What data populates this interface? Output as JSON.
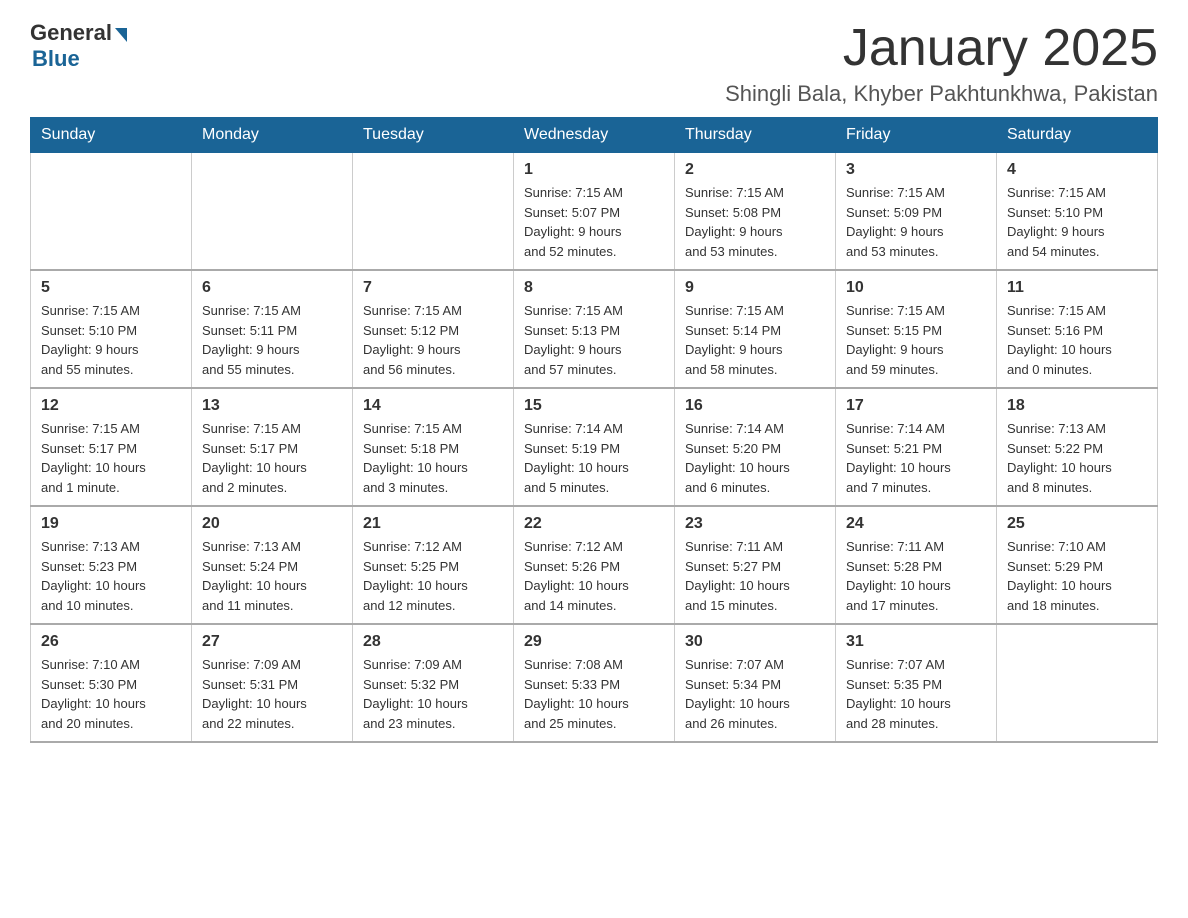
{
  "logo": {
    "general": "General",
    "blue": "Blue"
  },
  "title": "January 2025",
  "location": "Shingli Bala, Khyber Pakhtunkhwa, Pakistan",
  "headers": [
    "Sunday",
    "Monday",
    "Tuesday",
    "Wednesday",
    "Thursday",
    "Friday",
    "Saturday"
  ],
  "weeks": [
    [
      {
        "day": "",
        "info": ""
      },
      {
        "day": "",
        "info": ""
      },
      {
        "day": "",
        "info": ""
      },
      {
        "day": "1",
        "info": "Sunrise: 7:15 AM\nSunset: 5:07 PM\nDaylight: 9 hours\nand 52 minutes."
      },
      {
        "day": "2",
        "info": "Sunrise: 7:15 AM\nSunset: 5:08 PM\nDaylight: 9 hours\nand 53 minutes."
      },
      {
        "day": "3",
        "info": "Sunrise: 7:15 AM\nSunset: 5:09 PM\nDaylight: 9 hours\nand 53 minutes."
      },
      {
        "day": "4",
        "info": "Sunrise: 7:15 AM\nSunset: 5:10 PM\nDaylight: 9 hours\nand 54 minutes."
      }
    ],
    [
      {
        "day": "5",
        "info": "Sunrise: 7:15 AM\nSunset: 5:10 PM\nDaylight: 9 hours\nand 55 minutes."
      },
      {
        "day": "6",
        "info": "Sunrise: 7:15 AM\nSunset: 5:11 PM\nDaylight: 9 hours\nand 55 minutes."
      },
      {
        "day": "7",
        "info": "Sunrise: 7:15 AM\nSunset: 5:12 PM\nDaylight: 9 hours\nand 56 minutes."
      },
      {
        "day": "8",
        "info": "Sunrise: 7:15 AM\nSunset: 5:13 PM\nDaylight: 9 hours\nand 57 minutes."
      },
      {
        "day": "9",
        "info": "Sunrise: 7:15 AM\nSunset: 5:14 PM\nDaylight: 9 hours\nand 58 minutes."
      },
      {
        "day": "10",
        "info": "Sunrise: 7:15 AM\nSunset: 5:15 PM\nDaylight: 9 hours\nand 59 minutes."
      },
      {
        "day": "11",
        "info": "Sunrise: 7:15 AM\nSunset: 5:16 PM\nDaylight: 10 hours\nand 0 minutes."
      }
    ],
    [
      {
        "day": "12",
        "info": "Sunrise: 7:15 AM\nSunset: 5:17 PM\nDaylight: 10 hours\nand 1 minute."
      },
      {
        "day": "13",
        "info": "Sunrise: 7:15 AM\nSunset: 5:17 PM\nDaylight: 10 hours\nand 2 minutes."
      },
      {
        "day": "14",
        "info": "Sunrise: 7:15 AM\nSunset: 5:18 PM\nDaylight: 10 hours\nand 3 minutes."
      },
      {
        "day": "15",
        "info": "Sunrise: 7:14 AM\nSunset: 5:19 PM\nDaylight: 10 hours\nand 5 minutes."
      },
      {
        "day": "16",
        "info": "Sunrise: 7:14 AM\nSunset: 5:20 PM\nDaylight: 10 hours\nand 6 minutes."
      },
      {
        "day": "17",
        "info": "Sunrise: 7:14 AM\nSunset: 5:21 PM\nDaylight: 10 hours\nand 7 minutes."
      },
      {
        "day": "18",
        "info": "Sunrise: 7:13 AM\nSunset: 5:22 PM\nDaylight: 10 hours\nand 8 minutes."
      }
    ],
    [
      {
        "day": "19",
        "info": "Sunrise: 7:13 AM\nSunset: 5:23 PM\nDaylight: 10 hours\nand 10 minutes."
      },
      {
        "day": "20",
        "info": "Sunrise: 7:13 AM\nSunset: 5:24 PM\nDaylight: 10 hours\nand 11 minutes."
      },
      {
        "day": "21",
        "info": "Sunrise: 7:12 AM\nSunset: 5:25 PM\nDaylight: 10 hours\nand 12 minutes."
      },
      {
        "day": "22",
        "info": "Sunrise: 7:12 AM\nSunset: 5:26 PM\nDaylight: 10 hours\nand 14 minutes."
      },
      {
        "day": "23",
        "info": "Sunrise: 7:11 AM\nSunset: 5:27 PM\nDaylight: 10 hours\nand 15 minutes."
      },
      {
        "day": "24",
        "info": "Sunrise: 7:11 AM\nSunset: 5:28 PM\nDaylight: 10 hours\nand 17 minutes."
      },
      {
        "day": "25",
        "info": "Sunrise: 7:10 AM\nSunset: 5:29 PM\nDaylight: 10 hours\nand 18 minutes."
      }
    ],
    [
      {
        "day": "26",
        "info": "Sunrise: 7:10 AM\nSunset: 5:30 PM\nDaylight: 10 hours\nand 20 minutes."
      },
      {
        "day": "27",
        "info": "Sunrise: 7:09 AM\nSunset: 5:31 PM\nDaylight: 10 hours\nand 22 minutes."
      },
      {
        "day": "28",
        "info": "Sunrise: 7:09 AM\nSunset: 5:32 PM\nDaylight: 10 hours\nand 23 minutes."
      },
      {
        "day": "29",
        "info": "Sunrise: 7:08 AM\nSunset: 5:33 PM\nDaylight: 10 hours\nand 25 minutes."
      },
      {
        "day": "30",
        "info": "Sunrise: 7:07 AM\nSunset: 5:34 PM\nDaylight: 10 hours\nand 26 minutes."
      },
      {
        "day": "31",
        "info": "Sunrise: 7:07 AM\nSunset: 5:35 PM\nDaylight: 10 hours\nand 28 minutes."
      },
      {
        "day": "",
        "info": ""
      }
    ]
  ]
}
